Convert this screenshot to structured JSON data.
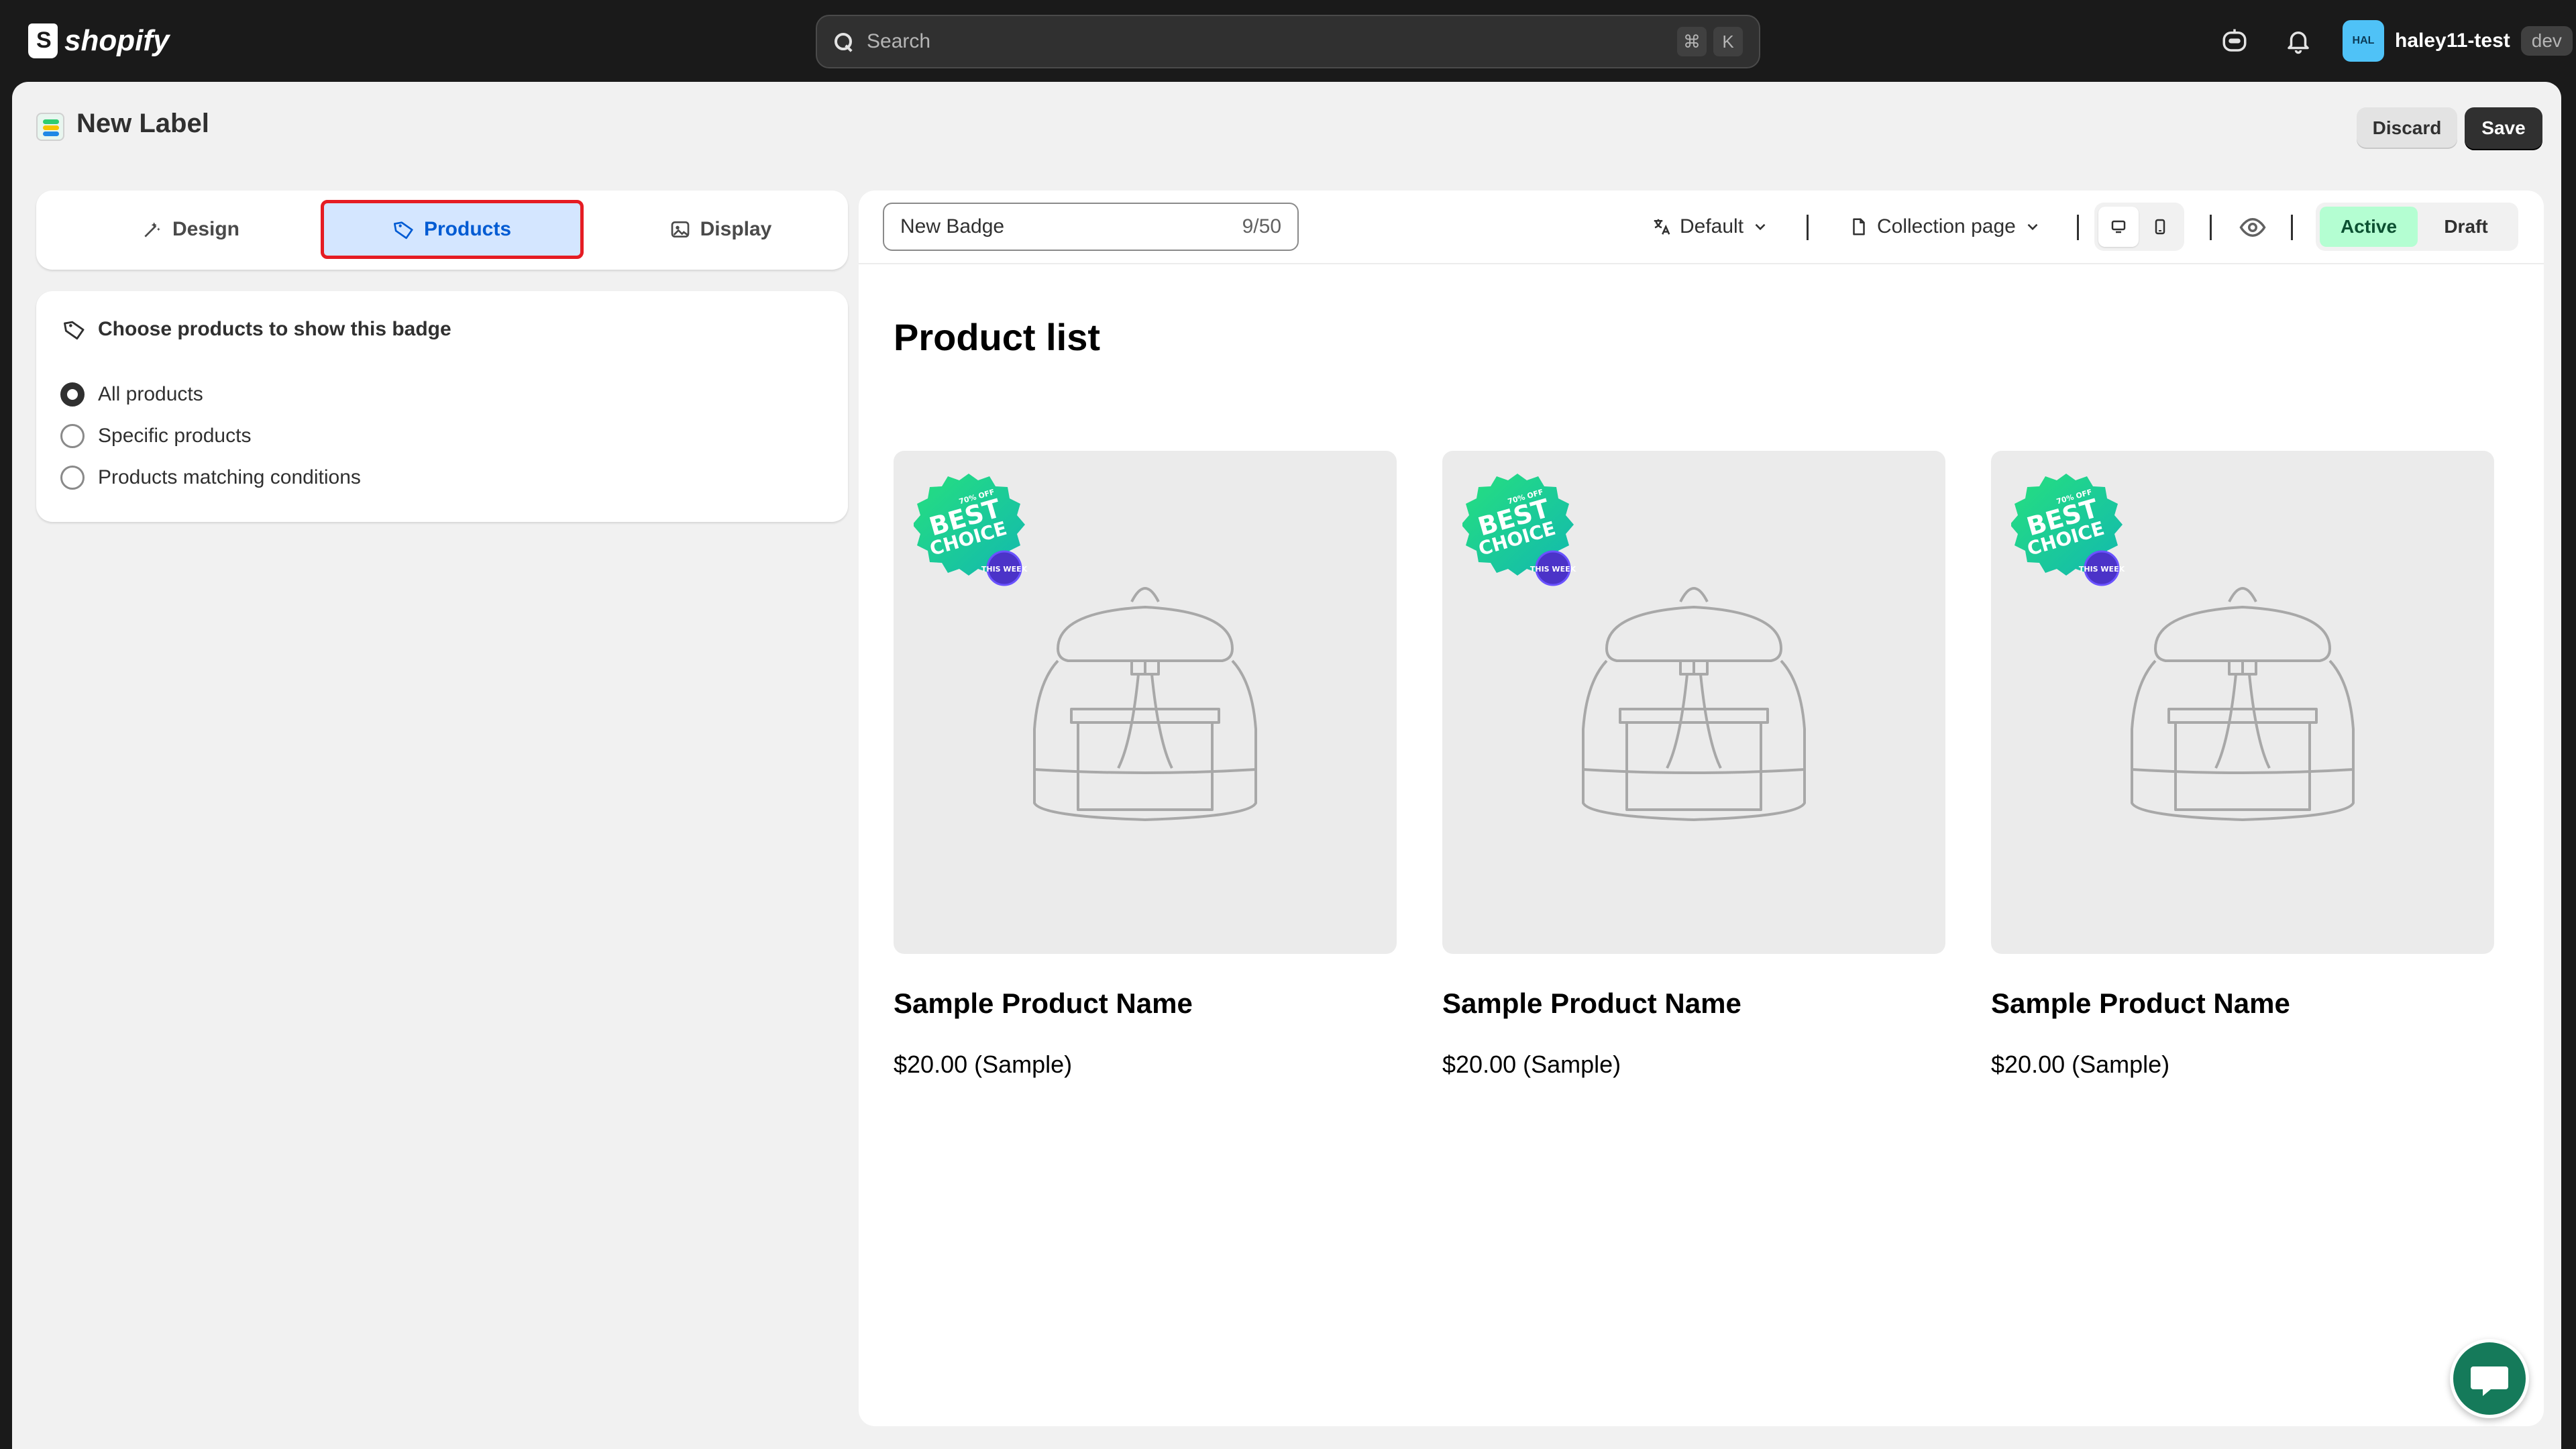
{
  "topbar": {
    "brand": "shopify",
    "search_placeholder": "Search",
    "shortcut_cmd": "⌘",
    "shortcut_key": "K",
    "avatar_initials": "HAL",
    "store_name": "haley11-test",
    "env_tag": "dev"
  },
  "header": {
    "title": "New Label",
    "discard_label": "Discard",
    "save_label": "Save"
  },
  "tabs": [
    {
      "label": "Design",
      "icon": "magic-wand-icon"
    },
    {
      "label": "Products",
      "icon": "tag-icon",
      "active": true
    },
    {
      "label": "Display",
      "icon": "image-frame-icon"
    }
  ],
  "products_panel": {
    "title": "Choose products to show this badge",
    "options": [
      {
        "label": "All products",
        "selected": true
      },
      {
        "label": "Specific products",
        "selected": false
      },
      {
        "label": "Products matching conditions",
        "selected": false
      }
    ]
  },
  "preview_toolbar": {
    "badge_name": "New Badge",
    "char_count": "9/50",
    "template_select": "Default",
    "page_select": "Collection page",
    "status_active": "Active",
    "status_draft": "Draft"
  },
  "preview": {
    "list_title": "Product list",
    "sticker": {
      "top": "70% OFF",
      "line1": "BEST",
      "line2": "CHOICE",
      "mini": "THIS WEEK"
    },
    "products": [
      {
        "name": "Sample Product Name",
        "price": "$20.00 (Sample)"
      },
      {
        "name": "Sample Product Name",
        "price": "$20.00 (Sample)"
      },
      {
        "name": "Sample Product Name",
        "price": "$20.00 (Sample)"
      }
    ]
  },
  "colors": {
    "accent_blue": "#005bd3",
    "highlight_red": "#e51c23",
    "active_green": "#b4fed2",
    "chat_green": "#157a5a"
  }
}
